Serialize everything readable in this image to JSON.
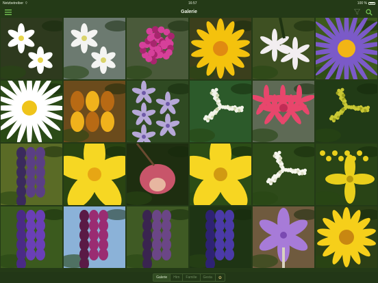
{
  "status_bar": {
    "carrier": "Netzbetreiber",
    "time": "16:57",
    "battery": "100 %"
  },
  "nav": {
    "title": "Galerie",
    "menu_icon": "hamburger-icon",
    "filter_icon": "funnel-icon",
    "search_icon": "search-icon"
  },
  "gallery": {
    "columns": 6,
    "rows": 4,
    "tiles": [
      {
        "kind": "white-star",
        "bg": "#2e3a1e",
        "petal": "#ffffff",
        "center": "#e8d64a"
      },
      {
        "kind": "white-star",
        "bg": "#6c7a70",
        "petal": "#f4f4f2",
        "center": "#d9d36a"
      },
      {
        "kind": "pom",
        "bg": "#4a5a3a",
        "petal": "#d6409a",
        "center": "#a8256e"
      },
      {
        "kind": "star-yellow",
        "bg": "#3b3f1c",
        "petal": "#f4c20d",
        "center": "#e08a12"
      },
      {
        "kind": "lily",
        "bg": "#3e5022",
        "petal": "#f2eef0",
        "center": "#b97aa7"
      },
      {
        "kind": "aster",
        "bg": "#3d5a1c",
        "petal": "#7b5ac8",
        "center": "#f2b515"
      },
      {
        "kind": "daisy",
        "bg": "#2c4b18",
        "petal": "#ffffff",
        "center": "#efc41a"
      },
      {
        "kind": "bells",
        "bg": "#6b4b1c",
        "petal": "#f0b21c",
        "center": "#b86a14"
      },
      {
        "kind": "orchid",
        "bg": "#2f4a22",
        "petal": "#b6a8d8",
        "center": "#6f5aa8"
      },
      {
        "kind": "umbel",
        "bg": "#2c5a2a",
        "petal": "#f3f3ea",
        "center": "#cfd7b0"
      },
      {
        "kind": "pink-spray",
        "bg": "#5e6a55",
        "petal": "#e8466c",
        "center": "#c02c55"
      },
      {
        "kind": "umbel",
        "bg": "#213b16",
        "petal": "#c9c834",
        "center": "#9ea11e"
      },
      {
        "kind": "spike",
        "bg": "#5a6b26",
        "petal": "#5a3f84",
        "center": "#3a2a5c"
      },
      {
        "kind": "cup",
        "bg": "#2a4412",
        "petal": "#f6d723",
        "center": "#e7a614"
      },
      {
        "kind": "nodding",
        "bg": "#1e2e10",
        "petal": "#c8556a",
        "center": "#e7b6a0"
      },
      {
        "kind": "cup",
        "bg": "#2c4d16",
        "petal": "#f7d622",
        "center": "#d19a12"
      },
      {
        "kind": "umbel",
        "bg": "#2e4b1a",
        "petal": "#f6f6ee",
        "center": "#dcdcc4"
      },
      {
        "kind": "cress",
        "bg": "#294416",
        "petal": "#e9cf1c",
        "center": "#b79a10"
      },
      {
        "kind": "spike",
        "bg": "#3b5a1e",
        "petal": "#6a3fb6",
        "center": "#4a2a86"
      },
      {
        "kind": "spike-pink",
        "bg": "#8bb2d8",
        "petal": "#9a2c72",
        "center": "#5a1a46"
      },
      {
        "kind": "spike-dark",
        "bg": "#3f5a24",
        "petal": "#6b4686",
        "center": "#3a2450"
      },
      {
        "kind": "spike",
        "bg": "#1e3414",
        "petal": "#4b3aa8",
        "center": "#2e2274"
      },
      {
        "kind": "crocus",
        "bg": "#6f5a3e",
        "petal": "#a77bd8",
        "center": "#7a4ab2"
      },
      {
        "kind": "star-yellow",
        "bg": "#2c3f16",
        "petal": "#f6cf1a",
        "center": "#c88712"
      }
    ]
  },
  "tabbar": {
    "tabs": [
      {
        "label": "Galerie",
        "active": true
      },
      {
        "label": "Hirn",
        "active": false
      },
      {
        "label": "Familie",
        "active": false
      },
      {
        "label": "Gesta",
        "active": false
      }
    ],
    "extra_icon": "flower-icon"
  }
}
